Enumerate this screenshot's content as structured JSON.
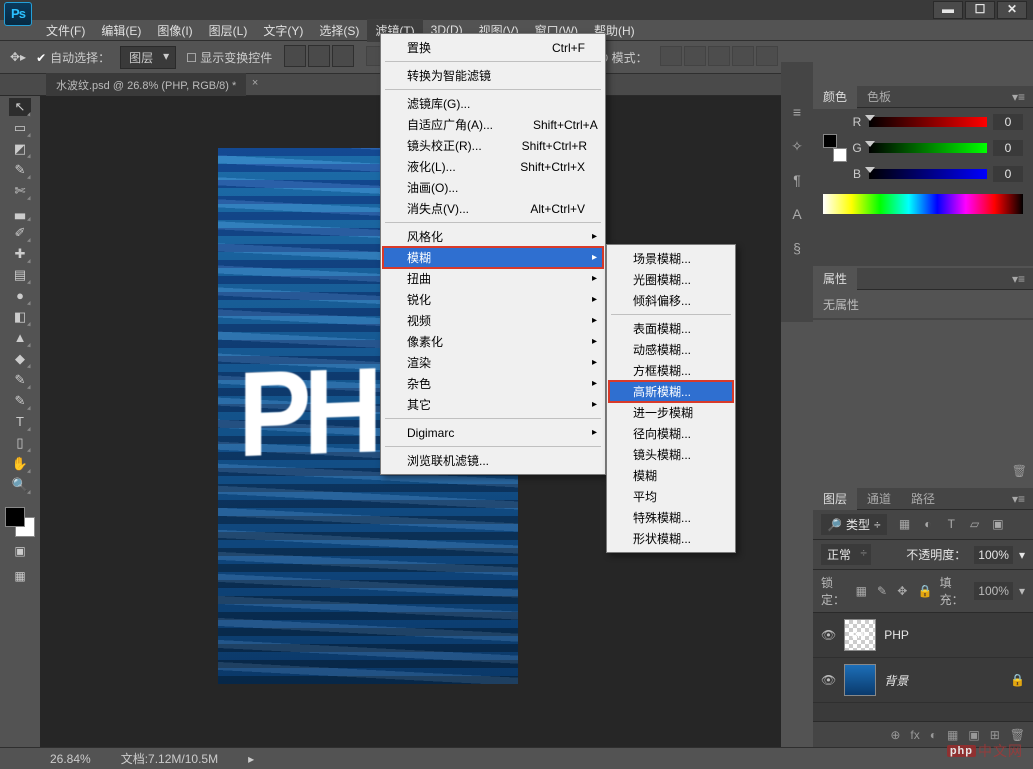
{
  "app": {
    "name": "Ps"
  },
  "window_controls": {
    "min": "▬",
    "max": "☐",
    "close": "✕"
  },
  "menubar": [
    "文件(F)",
    "编辑(E)",
    "图像(I)",
    "图层(L)",
    "文字(Y)",
    "选择(S)",
    "滤镜(T)",
    "3D(D)",
    "视图(V)",
    "窗口(W)",
    "帮助(H)"
  ],
  "menubar_active_index": 6,
  "options_bar": {
    "auto_select": "自动选择：",
    "layer_dd": "图层",
    "show_transform": "显示变换控件",
    "mode3d_label": "3D 模式："
  },
  "document_tab": "水波纹.psd @ 26.8% (PHP, RGB/8) *",
  "canvas": {
    "text": "PHP"
  },
  "tools": [
    "↖",
    "▭",
    "◩",
    "✎",
    "✄",
    "▃",
    "✐",
    "✚",
    "▤",
    "●",
    "◧",
    "▲",
    "◆",
    "✎",
    "✎",
    "T",
    "▯",
    "✋",
    "🔍"
  ],
  "panels_strip": [
    "≡",
    "✧",
    "¶",
    "A",
    "§"
  ],
  "color_panel": {
    "tabs": [
      "颜色",
      "色板"
    ],
    "channels": [
      {
        "label": "R",
        "value": "0"
      },
      {
        "label": "G",
        "value": "0"
      },
      {
        "label": "B",
        "value": "0"
      }
    ]
  },
  "properties_panel": {
    "tab": "属性",
    "body": "无属性"
  },
  "layers_panel": {
    "tabs": [
      "图层",
      "通道",
      "路径"
    ],
    "kind_label": "类型",
    "blend_mode": "正常",
    "opacity_label": "不透明度：",
    "opacity_value": "100%",
    "lock_label": "锁定：",
    "fill_label": "填充：",
    "fill_value": "100%",
    "layers": [
      {
        "name": "PHP",
        "bg": false
      },
      {
        "name": "背景",
        "bg": true
      }
    ],
    "footer_icons": [
      "⊕",
      "fx",
      "◐",
      "▦",
      "▣",
      "⊞",
      "🗑"
    ]
  },
  "statusbar": {
    "zoom": "26.84%",
    "docinfo": "文档:7.12M/10.5M"
  },
  "watermark": "中文网",
  "filter_menu": {
    "items": [
      {
        "label": "置换",
        "shortcut": "Ctrl+F"
      },
      {
        "sep": true
      },
      {
        "label": "转换为智能滤镜"
      },
      {
        "sep": true
      },
      {
        "label": "滤镜库(G)..."
      },
      {
        "label": "自适应广角(A)...",
        "shortcut": "Shift+Ctrl+A"
      },
      {
        "label": "镜头校正(R)...",
        "shortcut": "Shift+Ctrl+R"
      },
      {
        "label": "液化(L)...",
        "shortcut": "Shift+Ctrl+X"
      },
      {
        "label": "油画(O)..."
      },
      {
        "label": "消失点(V)...",
        "shortcut": "Alt+Ctrl+V"
      },
      {
        "sep": true
      },
      {
        "label": "风格化",
        "sub": true
      },
      {
        "label": "模糊",
        "sub": true,
        "highlight": true,
        "box": true
      },
      {
        "label": "扭曲",
        "sub": true
      },
      {
        "label": "锐化",
        "sub": true
      },
      {
        "label": "视频",
        "sub": true
      },
      {
        "label": "像素化",
        "sub": true
      },
      {
        "label": "渲染",
        "sub": true
      },
      {
        "label": "杂色",
        "sub": true
      },
      {
        "label": "其它",
        "sub": true
      },
      {
        "sep": true
      },
      {
        "label": "Digimarc",
        "sub": true
      },
      {
        "sep": true
      },
      {
        "label": "浏览联机滤镜..."
      }
    ]
  },
  "blur_submenu": {
    "items": [
      {
        "label": "场景模糊..."
      },
      {
        "label": "光圈模糊..."
      },
      {
        "label": "倾斜偏移..."
      },
      {
        "sep": true
      },
      {
        "label": "表面模糊..."
      },
      {
        "label": "动感模糊..."
      },
      {
        "label": "方框模糊..."
      },
      {
        "label": "高斯模糊...",
        "highlight": true,
        "box": true
      },
      {
        "label": "进一步模糊"
      },
      {
        "label": "径向模糊..."
      },
      {
        "label": "镜头模糊..."
      },
      {
        "label": "模糊"
      },
      {
        "label": "平均"
      },
      {
        "label": "特殊模糊..."
      },
      {
        "label": "形状模糊..."
      }
    ]
  }
}
